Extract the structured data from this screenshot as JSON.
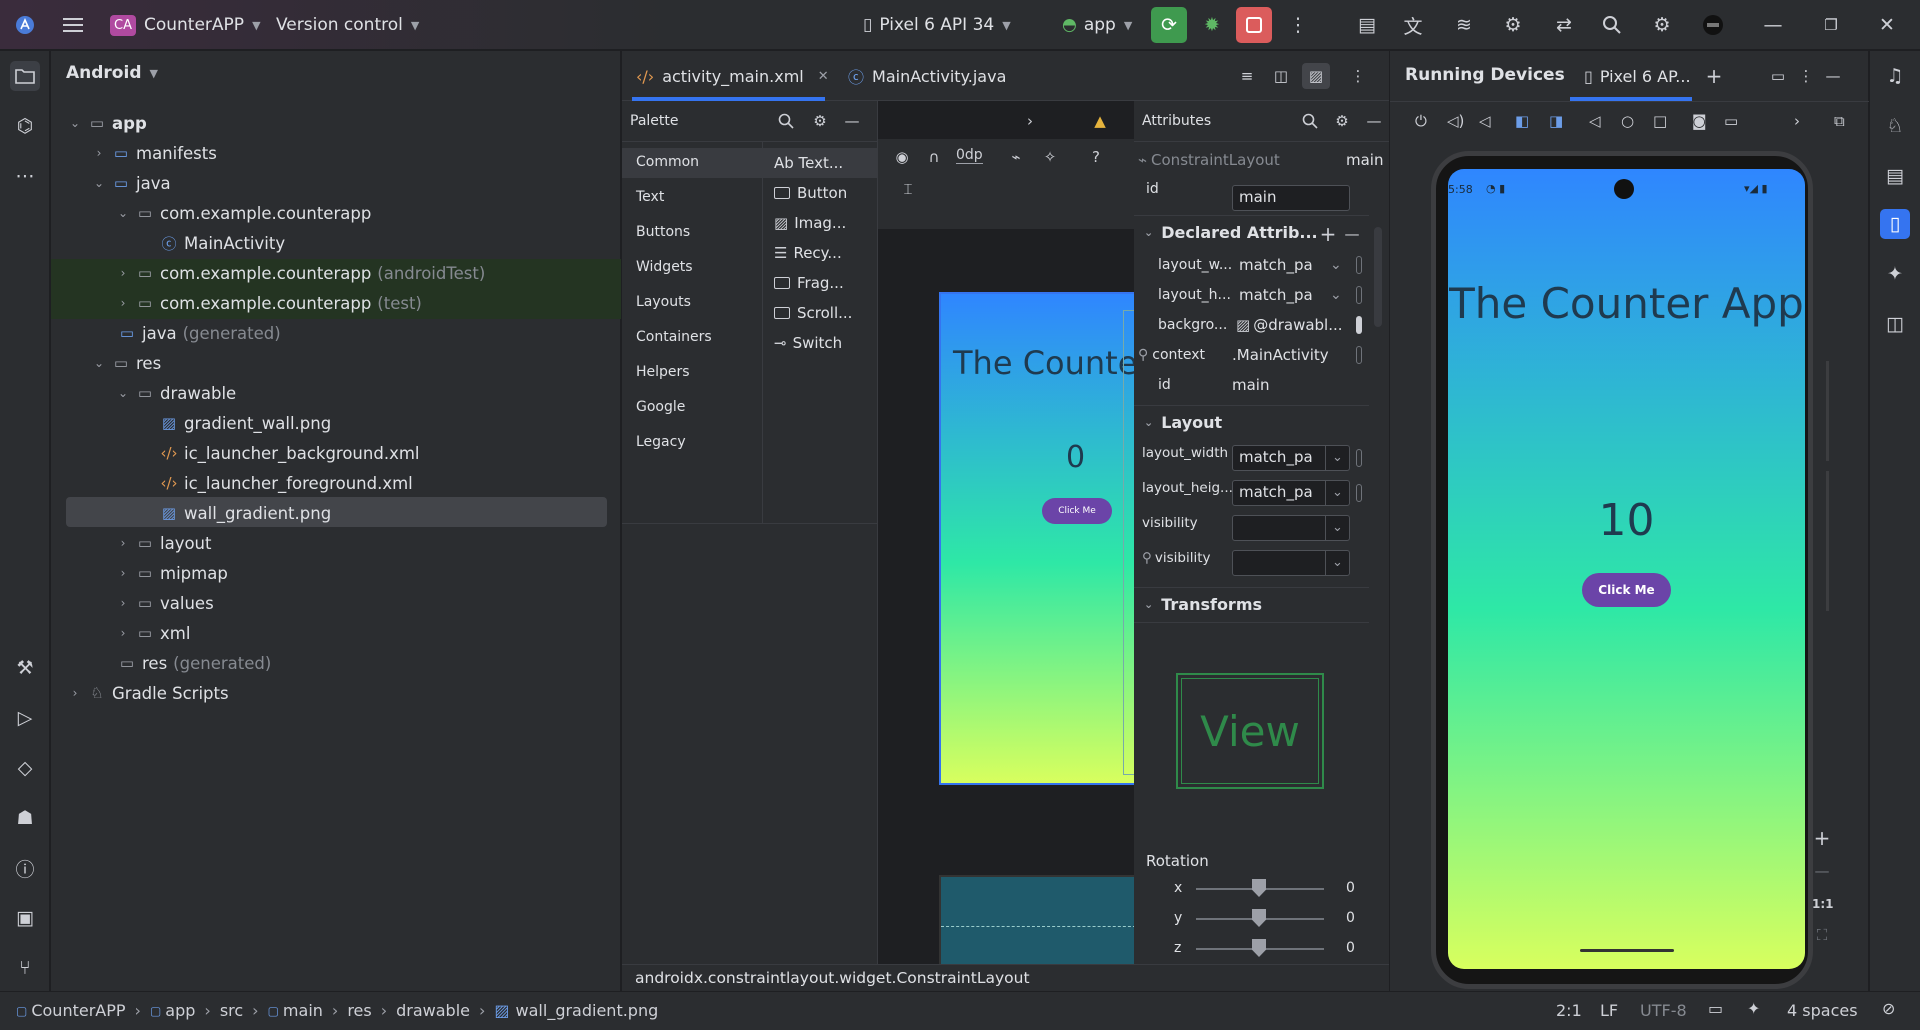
{
  "titlebar": {
    "project_badge": "CA",
    "project_name": "CounterAPP",
    "version_control": "Version control",
    "device": "Pixel 6 API 34",
    "run_config": "app"
  },
  "project_panel": {
    "view_mode": "Android",
    "tree": [
      {
        "label": "app",
        "suffix": ""
      },
      {
        "label": "manifests",
        "suffix": ""
      },
      {
        "label": "java",
        "suffix": ""
      },
      {
        "label": "com.example.counterapp",
        "suffix": ""
      },
      {
        "label": "MainActivity",
        "suffix": ""
      },
      {
        "label": "com.example.counterapp",
        "suffix": "(androidTest)"
      },
      {
        "label": "com.example.counterapp",
        "suffix": "(test)"
      },
      {
        "label": "java",
        "suffix": "(generated)"
      },
      {
        "label": "res",
        "suffix": ""
      },
      {
        "label": "drawable",
        "suffix": ""
      },
      {
        "label": "gradient_wall.png",
        "suffix": ""
      },
      {
        "label": "ic_launcher_background.xml",
        "suffix": ""
      },
      {
        "label": "ic_launcher_foreground.xml",
        "suffix": ""
      },
      {
        "label": "wall_gradient.png",
        "suffix": ""
      },
      {
        "label": "layout",
        "suffix": ""
      },
      {
        "label": "mipmap",
        "suffix": ""
      },
      {
        "label": "values",
        "suffix": ""
      },
      {
        "label": "xml",
        "suffix": ""
      },
      {
        "label": "res",
        "suffix": "(generated)"
      },
      {
        "label": "Gradle Scripts",
        "suffix": ""
      }
    ]
  },
  "editor": {
    "tabs": [
      "activity_main.xml",
      "MainActivity.java"
    ],
    "palette_title": "Palette",
    "palette_categories": [
      "Common",
      "Text",
      "Buttons",
      "Widgets",
      "Layouts",
      "Containers",
      "Helpers",
      "Google",
      "Legacy"
    ],
    "palette_items": [
      "Ab Text...",
      "Button",
      "Imag...",
      "Recy...",
      "Frag...",
      "Scroll...",
      "Switch"
    ],
    "dp_value": "0dp",
    "preview_title": "The Counter",
    "preview_count": "0",
    "preview_button": "Click Me",
    "component_path": "androidx.constraintlayout.widget.ConstraintLayout"
  },
  "attributes": {
    "title": "Attributes",
    "component": "ConstraintLayout",
    "component_id": "main",
    "id_label": "id",
    "id_value": "main",
    "declared_header": "Declared Attrib...",
    "declared": [
      {
        "name": "layout_w...",
        "value": "match_pa"
      },
      {
        "name": "layout_h...",
        "value": "match_pa"
      },
      {
        "name": "backgro...",
        "value": "@drawabl..."
      },
      {
        "name": "context",
        "value": ".MainActivity"
      },
      {
        "name": "id",
        "value": "main"
      }
    ],
    "layout_header": "Layout",
    "layout_rows": [
      {
        "name": "layout_width",
        "value": "match_pa"
      },
      {
        "name": "layout_heig...",
        "value": "match_pa"
      },
      {
        "name": "visibility",
        "value": ""
      },
      {
        "name": "visibility",
        "value": ""
      }
    ],
    "transforms_header": "Transforms",
    "view_preview": "View",
    "rotation_label": "Rotation",
    "rotation": [
      {
        "axis": "x",
        "value": "0"
      },
      {
        "axis": "y",
        "value": "0"
      },
      {
        "axis": "z",
        "value": "0"
      }
    ]
  },
  "running_devices": {
    "title": "Running Devices",
    "device_tab": "Pixel 6 AP...",
    "status_time": "5:58",
    "app_title": "The Counter App",
    "count": "10",
    "button": "Click Me",
    "zoom_ratio": "1:1"
  },
  "statusbar": {
    "breadcrumb": [
      "CounterAPP",
      "app",
      "src",
      "main",
      "res",
      "drawable",
      "wall_gradient.png"
    ],
    "position": "2:1",
    "line_sep": "LF",
    "encoding": "UTF-8",
    "indent": "4 spaces"
  },
  "colors": {
    "accent": "#3574f0",
    "run_green": "#3f9a4f",
    "stop_red": "#db5c5c",
    "button_purple": "#6b44a8",
    "gradient_top": "#2f86ff",
    "gradient_mid": "#2ee8a6",
    "gradient_bottom": "#d8ff5e"
  }
}
